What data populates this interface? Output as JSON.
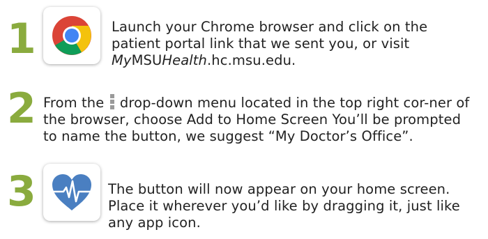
{
  "colors": {
    "step_number": "#8aab3e",
    "heart": "#4a7fc1",
    "text": "#222222"
  },
  "steps": [
    {
      "number": "1",
      "icon": "chrome-icon",
      "text_before": "Launch your Chrome browser and click on the patient portal link that we sent you, or visit ",
      "url_my": "My",
      "url_msu": "MSU",
      "url_health": "Health",
      "url_rest": ".hc.msu.edu."
    },
    {
      "number": "2",
      "icon": "kebab-menu-icon",
      "text_before": "From the ",
      "text_after": " drop-down menu located in the top right cor-ner of the browser, choose Add to Home Screen You’ll be prompted to name the button, we suggest “My Doctor’s Office”."
    },
    {
      "number": "3",
      "icon": "heart-pulse-icon",
      "text": "The button will now appear on your home screen. Place it wherever you’d like by dragging it, just like any app icon."
    }
  ]
}
